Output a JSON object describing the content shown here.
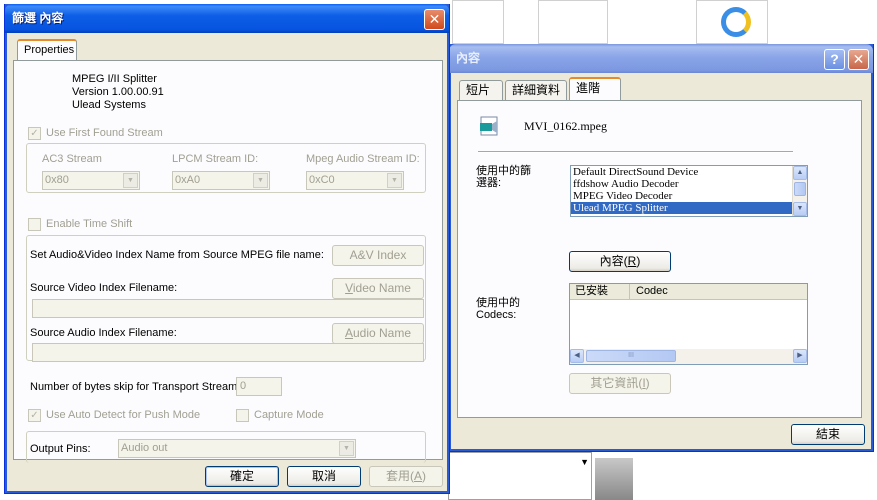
{
  "filter_dialog": {
    "title": "篩選 內容",
    "tab": "Properties",
    "info": [
      "MPEG I/II Splitter",
      "Version 1.00.00.91",
      "Ulead Systems"
    ],
    "use_first_found_stream": "Use First Found Stream",
    "ac3_label": "AC3 Stream",
    "lpcm_label": "LPCM Stream ID:",
    "mpeg_audio_label": "Mpeg Audio Stream ID:",
    "ac3_value": "0x80",
    "lpcm_value": "0xA0",
    "mpeg_audio_value": "0xC0",
    "enable_time_shift": "Enable Time Shift",
    "index_name_label": "Set Audio&Video Index Name from Source MPEG file name:",
    "av_index_button": "A&V Index",
    "video_index_label": "Source Video Index Filename:",
    "video_name_button": "Video Name",
    "audio_index_label": "Source Audio Index Filename:",
    "audio_name_button": "Audio Name",
    "bytes_skip_label": "Number of bytes skip for Transport Stream:",
    "bytes_skip_value": "0",
    "auto_detect_label": "Use Auto Detect for Push Mode",
    "capture_mode_label": "Capture Mode",
    "output_pins_label": "Output Pins:",
    "output_pins_value": "Audio out",
    "ok_button": "確定",
    "cancel_button": "取消",
    "apply_button": "套用(A)"
  },
  "props_dialog": {
    "title": "內容",
    "tabs": [
      "短片",
      "詳細資料",
      "進階"
    ],
    "file_name": "MVI_0162.mpeg",
    "filters_label_1": "使用中的篩",
    "filters_label_2": "選器:",
    "filters": [
      "Default DirectSound Device",
      "ffdshow Audio Decoder",
      "MPEG Video Decoder",
      "Ulead MPEG Splitter"
    ],
    "filter_selected_index": 3,
    "properties_button": "內容(R)",
    "codecs_label_1": "使用中的",
    "codecs_label_2": "Codecs:",
    "codec_columns": [
      "已安裝",
      "Codec"
    ],
    "more_info_button": "其它資訊(I)",
    "close_button": "結束"
  },
  "background": {
    "left_chars": [
      "\u0002",
      "\u0002"
    ],
    "scroll_caret": "III"
  }
}
